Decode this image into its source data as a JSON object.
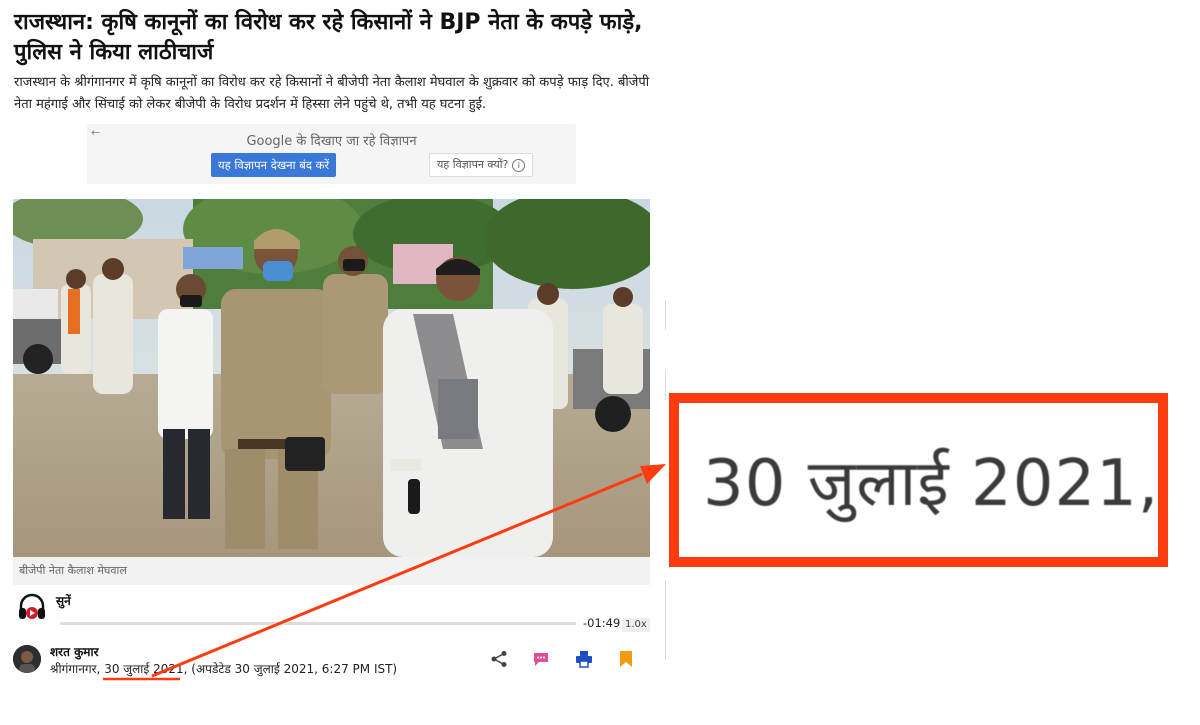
{
  "article": {
    "headline": "राजस्थान: कृषि कानूनों का विरोध कर रहे किसानों ने BJP नेता के कपड़े फाड़े, पुलिस ने किया लाठीचार्ज",
    "summary": "राजस्थान के श्रीगंगानगर में कृषि कानूनों का विरोध कर रहे किसानों ने बीजेपी नेता कैलाश मेघवाल के शुक्रवार को कपड़े फाड़ दिए. बीजेपी नेता महंगाई और सिंचाई को लेकर बीजेपी के विरोध प्रदर्शन में हिस्सा लेने पहुंचे थे, तभी यह घटना हुई.",
    "photo_caption": "बीजेपी नेता कैलाश मेघवाल"
  },
  "ad": {
    "back_arrow": "←",
    "title_brand": "Google",
    "title_rest": " के दिखाए जा रहे विज्ञापन",
    "stop_button": "यह विज्ञापन देखना बंद करें",
    "why_button": "यह विज्ञापन क्यों?",
    "info_glyph": "i"
  },
  "audio": {
    "listen_label": "सुनें",
    "time": "-01:49",
    "speed": "1.0x",
    "progress": 0.0
  },
  "byline": {
    "author": "शरत कुमार",
    "location": "श्रीगंगानगर, ",
    "date": "30 जुलाई 2021",
    "updated": ", (अपडेटेड 30 जुलाई 2021, 6:27 PM IST)"
  },
  "annotation": {
    "zoom_text": "30 जुलाई 2021,",
    "highlight_color": "#ff3b10"
  },
  "icons": {
    "listen": "headphones-icon",
    "share": "share-icon",
    "comment": "comment-icon",
    "print": "print-icon",
    "bookmark": "bookmark-icon"
  },
  "colors": {
    "ad_button": "#3a78d8",
    "comment": "#e0509a",
    "print": "#1f4fbf",
    "bookmark": "#f39c12"
  }
}
